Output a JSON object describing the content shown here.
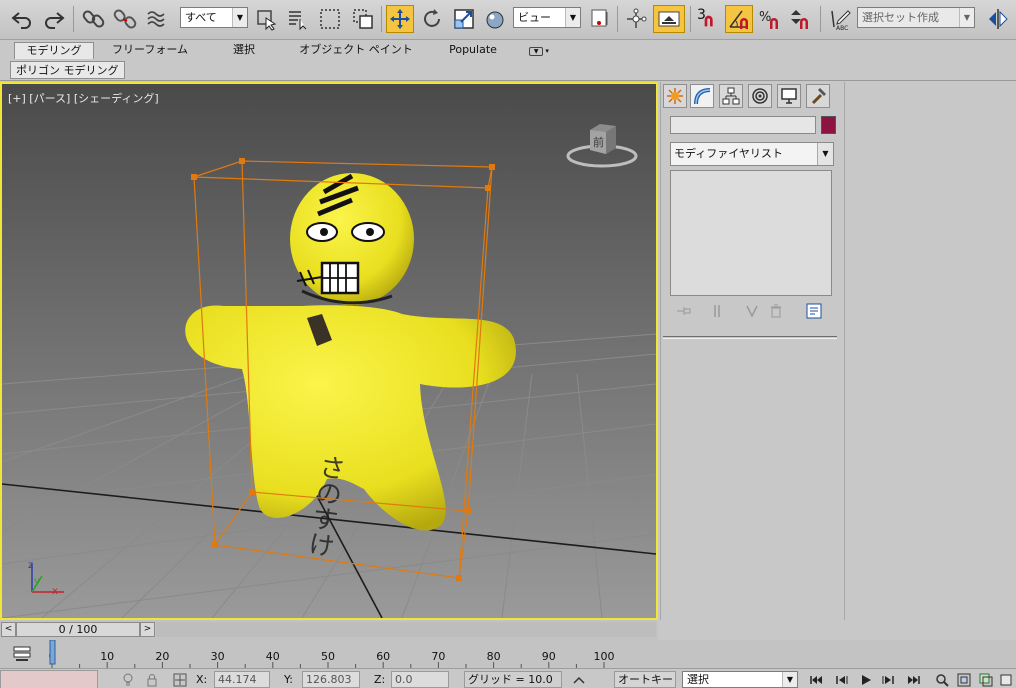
{
  "toolbar": {
    "selection_filter": "すべて",
    "reference_coord": "ビュー",
    "snap_label": "3",
    "named_selection_placeholder": "選択セット作成"
  },
  "ribbon": {
    "tabs": [
      "モデリング",
      "フリーフォーム",
      "選択",
      "オブジェクト ペイント",
      "Populate"
    ],
    "active_tab": "モデリング",
    "panel_button": "ポリゴン モデリング"
  },
  "viewport": {
    "label": "[+] [パース] [シェーディング]",
    "viewcube_face": "前",
    "axis_labels": {
      "x": "x",
      "y": "y",
      "z": "z"
    },
    "model_text": "さのすけ"
  },
  "command_panel": {
    "modifier_list": "モディファイヤリスト",
    "object_color": "#8c1442"
  },
  "time_slider": {
    "frame_display": "0 / 100",
    "prev": "<",
    "next": ">"
  },
  "trackbar": {
    "ticks": [
      "0",
      "10",
      "20",
      "30",
      "40",
      "50",
      "60",
      "70",
      "80",
      "90",
      "100"
    ]
  },
  "status": {
    "x_label": "X:",
    "x_value": "44.174",
    "y_label": "Y:",
    "y_value": "126.803",
    "z_label": "Z:",
    "z_value": "0.0",
    "grid": "グリッド = 10.0",
    "auto_key": "オートキー",
    "key_mode": "選択"
  }
}
